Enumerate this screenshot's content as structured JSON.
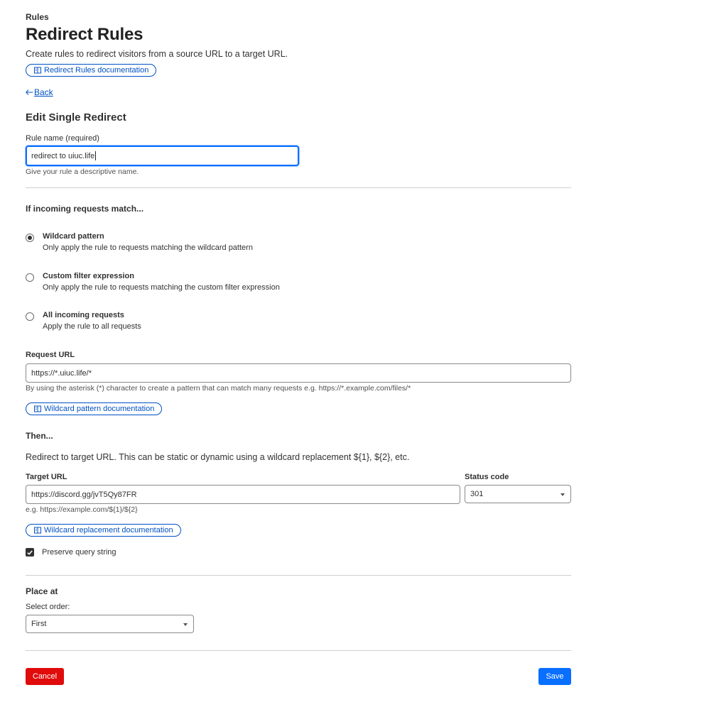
{
  "header": {
    "eyebrow": "Rules",
    "title": "Redirect Rules",
    "description": "Create rules to redirect visitors from a source URL to a target URL.",
    "doc_link": "Redirect Rules documentation",
    "back_label": "Back"
  },
  "form": {
    "heading": "Edit Single Redirect",
    "rule_name_label": "Rule name (required)",
    "rule_name_value": "redirect to uiuc.life",
    "rule_name_help": "Give your rule a descriptive name."
  },
  "match": {
    "heading": "If incoming requests match...",
    "options": [
      {
        "title": "Wildcard pattern",
        "sub": "Only apply the rule to requests matching the wildcard pattern",
        "selected": true
      },
      {
        "title": "Custom filter expression",
        "sub": "Only apply the rule to requests matching the custom filter expression",
        "selected": false
      },
      {
        "title": "All incoming requests",
        "sub": "Apply the rule to all requests",
        "selected": false
      }
    ],
    "request_url_label": "Request URL",
    "request_url_value": "https://*.uiuc.life/*",
    "request_url_help": "By using the asterisk (*) character to create a pattern that can match many requests e.g. https://*.example.com/files/*",
    "doc_link": "Wildcard pattern documentation"
  },
  "then": {
    "heading": "Then...",
    "description": "Redirect to target URL. This can be static or dynamic using a wildcard replacement ${1}, ${2}, etc.",
    "target_url_label": "Target URL",
    "target_url_value": "https://discord.gg/jvT5Qy87FR",
    "target_url_help": "e.g. https://example.com/${1}/${2}",
    "status_code_label": "Status code",
    "status_code_value": "301",
    "doc_link": "Wildcard replacement documentation",
    "preserve_label": "Preserve query string",
    "preserve_checked": true
  },
  "place": {
    "heading": "Place at",
    "order_label": "Select order:",
    "order_value": "First"
  },
  "footer": {
    "cancel_label": "Cancel",
    "save_label": "Save"
  },
  "colors": {
    "accent": "#086fff",
    "link": "#0051c3",
    "danger": "#e00b0b"
  }
}
